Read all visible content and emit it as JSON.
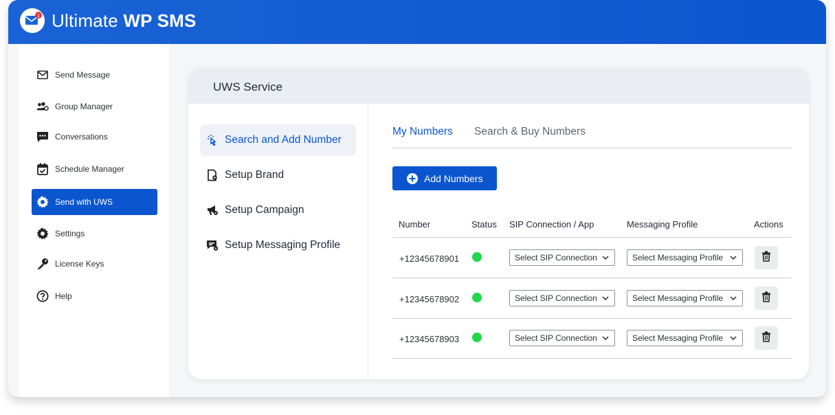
{
  "app": {
    "brand_light": "Ultimate ",
    "brand_bold": "WP SMS",
    "logo_badge": "1"
  },
  "colors": {
    "primary": "#0b56cf",
    "status_green": "#22d74c",
    "header_gray": "#eaeef3"
  },
  "sidebar": {
    "items": [
      {
        "label": "Send Message",
        "icon": "envelope-icon"
      },
      {
        "label": "Group Manager",
        "icon": "users-gear-icon"
      },
      {
        "label": "Conversations",
        "icon": "chat-icon"
      },
      {
        "label": "Schedule Manager",
        "icon": "calendar-check-icon"
      },
      {
        "label": "Send with UWS",
        "icon": "gear-icon",
        "active": true
      },
      {
        "label": "Settings",
        "icon": "gear-icon"
      },
      {
        "label": "License Keys",
        "icon": "key-icon"
      },
      {
        "label": "Help",
        "icon": "question-icon"
      }
    ]
  },
  "card": {
    "title": "UWS Service",
    "nav": [
      {
        "label": "Search and Add Number",
        "icon": "pointer-icon",
        "active": true
      },
      {
        "label": "Setup Brand",
        "icon": "brand-file-icon"
      },
      {
        "label": "Setup Campaign",
        "icon": "megaphone-icon"
      },
      {
        "label": "Setup Messaging Profile",
        "icon": "profile-chat-icon"
      }
    ],
    "tabs": [
      {
        "label": "My Numbers",
        "active": true
      },
      {
        "label": "Search & Buy Numbers",
        "active": false
      }
    ],
    "add_button": "Add Numbers",
    "table": {
      "headers": [
        "Number",
        "Status",
        "SIP Connection / App",
        "Messaging Profile",
        "Actions"
      ],
      "rows": [
        {
          "number": "+12345678901",
          "status": "active",
          "sip": "Select SIP Connection",
          "profile": "Select Messaging Profile"
        },
        {
          "number": "+12345678902",
          "status": "active",
          "sip": "Select SIP Connection",
          "profile": "Select Messaging Profile"
        },
        {
          "number": "+12345678903",
          "status": "active",
          "sip": "Select SIP Connection",
          "profile": "Select Messaging Profile"
        }
      ]
    }
  }
}
